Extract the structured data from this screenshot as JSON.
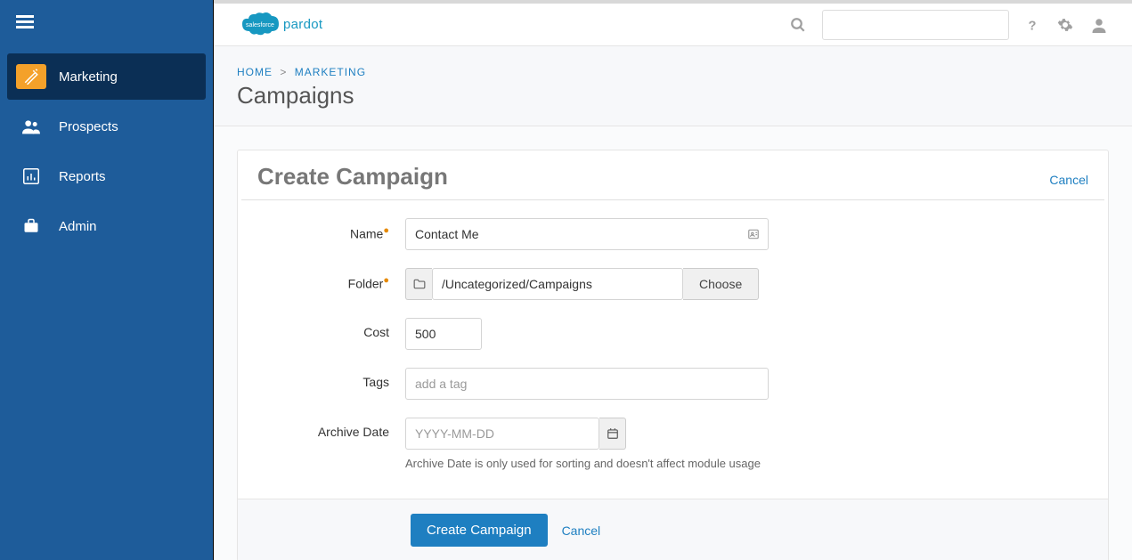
{
  "brand": {
    "name": "pardot"
  },
  "sidebar": {
    "items": [
      {
        "label": "Marketing",
        "icon": "wand-icon",
        "active": true
      },
      {
        "label": "Prospects",
        "icon": "users-icon",
        "active": false
      },
      {
        "label": "Reports",
        "icon": "bar-chart-icon",
        "active": false
      },
      {
        "label": "Admin",
        "icon": "briefcase-icon",
        "active": false
      }
    ]
  },
  "breadcrumb": {
    "home": "HOME",
    "section": "MARKETING"
  },
  "page": {
    "title": "Campaigns"
  },
  "panel": {
    "title": "Create Campaign",
    "cancel": "Cancel"
  },
  "form": {
    "name": {
      "label": "Name",
      "value": "Contact Me",
      "required": true
    },
    "folder": {
      "label": "Folder",
      "value": "/Uncategorized/Campaigns",
      "choose": "Choose",
      "required": true
    },
    "cost": {
      "label": "Cost",
      "value": "500"
    },
    "tags": {
      "label": "Tags",
      "placeholder": "add a tag"
    },
    "archive": {
      "label": "Archive Date",
      "placeholder": "YYYY-MM-DD",
      "help": "Archive Date is only used for sorting and doesn't affect module usage"
    }
  },
  "actions": {
    "submit": "Create Campaign",
    "cancel": "Cancel"
  }
}
